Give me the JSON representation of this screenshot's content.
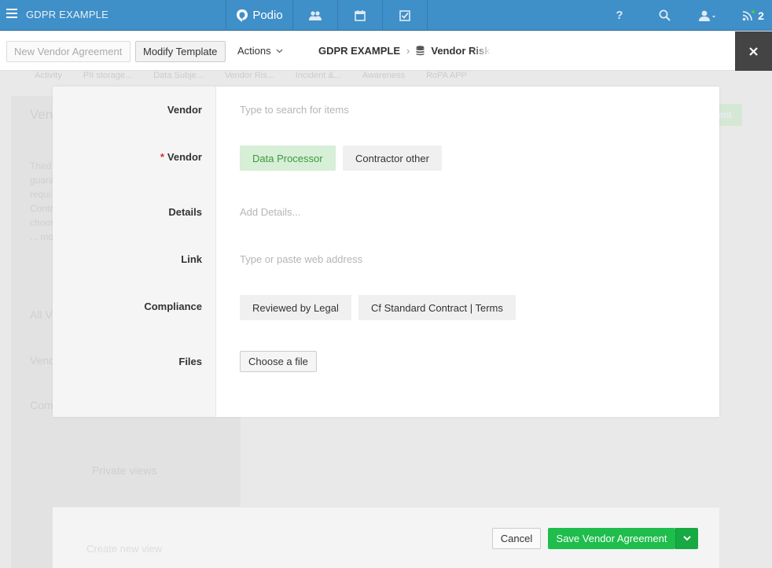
{
  "topbar": {
    "workspace_title": "GDPR EXAMPLE",
    "logo_text": "Podio",
    "help_label": "?",
    "notification_count": "2"
  },
  "toolbar": {
    "new_label": "New Vendor Agreement",
    "modify_label": "Modify Template",
    "actions_label": "Actions",
    "crumb_workspace": "GDPR EXAMPLE",
    "crumb_app": "Vendor Risk"
  },
  "background": {
    "tabs": [
      "Activity",
      "PII storage...",
      "Data Subje...",
      "Vendor Ris...",
      "Incident &...",
      "Awareness",
      "RoPA APP"
    ],
    "ghost_title": "Vend",
    "ghost_desc": [
      "Third",
      "guara",
      "requi",
      "Contr",
      "choos",
      "... mo"
    ],
    "ghost_all": "All V",
    "ghost_vend": "Vend",
    "ghost_comp": "Com",
    "private_views": "Private views",
    "green_label": "ent",
    "create_view": "Create new view"
  },
  "form": {
    "fields": [
      {
        "label": "Vendor",
        "required": false,
        "placeholder": "Type to search for items"
      },
      {
        "label": "Vendor",
        "required": true
      },
      {
        "label": "Details",
        "required": false,
        "placeholder": "Add Details..."
      },
      {
        "label": "Link",
        "required": false,
        "placeholder": "Type or paste web address"
      },
      {
        "label": "Compliance",
        "required": false
      },
      {
        "label": "Files",
        "required": false
      }
    ],
    "required_marker": "*",
    "vendor_options": [
      "Data Processor",
      "Contractor other"
    ],
    "vendor_selected": "Data Processor",
    "compliance_options": [
      "Reviewed by Legal",
      "Cf Standard Contract | Terms"
    ],
    "file_button": "Choose a file"
  },
  "footer": {
    "cancel_label": "Cancel",
    "save_label": "Save Vendor Agreement"
  },
  "colors": {
    "topbar": "#3f8fc8",
    "save_green": "#1ebd4c",
    "selected_chip_bg": "#d7eed7",
    "selected_chip_text": "#3c9a3c",
    "required_red": "#c33"
  }
}
